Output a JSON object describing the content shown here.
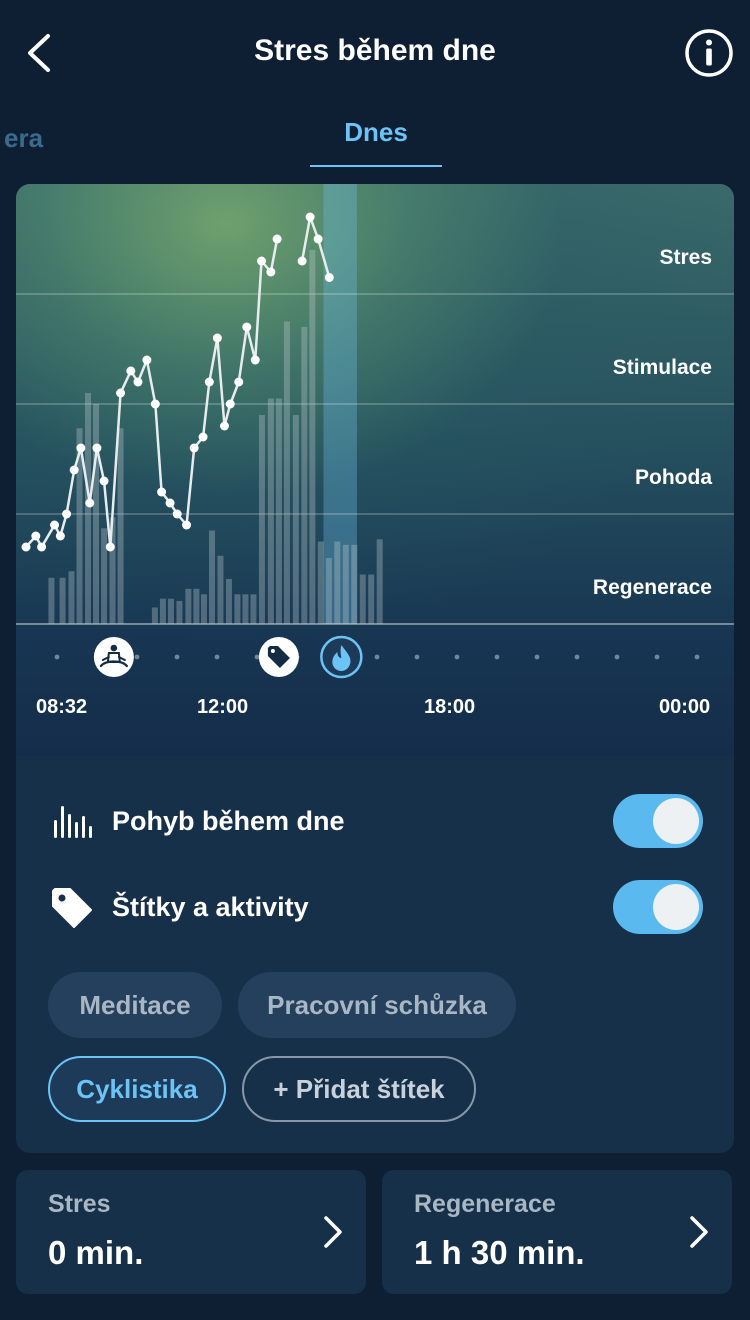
{
  "header": {
    "title": "Stres během dne",
    "back_icon": "chevron-left-icon",
    "info_icon": "info-icon"
  },
  "tabs": {
    "previous_partial": "era",
    "active": "Dnes"
  },
  "colors": {
    "accent": "#6cc3f5",
    "line": "#e8ecef",
    "bars": "rgba(190,200,205,0.35)",
    "highlight": "rgba(110,190,230,0.35)"
  },
  "chart_data": {
    "type": "line",
    "zones": [
      "Stres",
      "Stimulace",
      "Pohoda",
      "Regenerace"
    ],
    "x_ticks": [
      "08:32",
      "12:00",
      "18:00",
      "00:00"
    ],
    "x_range": [
      8.53,
      24
    ],
    "level_series": {
      "x": [
        8.53,
        8.75,
        8.88,
        9.17,
        9.3,
        9.44,
        9.61,
        9.76,
        9.96,
        10.12,
        10.28,
        10.42,
        10.65,
        10.88,
        11.04,
        11.24,
        11.43,
        11.57,
        11.76,
        11.92,
        12.13,
        12.3,
        12.5,
        12.64,
        12.82,
        12.98,
        13.11,
        13.3,
        13.48,
        13.67,
        13.81,
        14.02,
        14.16,
        14.72,
        14.9,
        15.08,
        15.33
      ],
      "y": [
        0.7,
        0.8,
        0.7,
        0.9,
        0.8,
        1.0,
        1.4,
        1.6,
        1.1,
        1.6,
        1.3,
        0.7,
        2.1,
        2.3,
        2.2,
        2.4,
        2.0,
        1.2,
        1.1,
        1.0,
        0.9,
        1.6,
        1.7,
        2.2,
        2.6,
        1.8,
        2.0,
        2.2,
        2.7,
        2.4,
        3.3,
        3.2,
        3.5,
        3.3,
        3.7,
        3.5,
        3.15
      ]
    },
    "activity_series": {
      "x": [
        9.1,
        9.35,
        9.55,
        9.73,
        9.92,
        10.1,
        10.28,
        10.47,
        10.65,
        10.84,
        11.03,
        11.22,
        11.42,
        11.6,
        11.78,
        11.97,
        12.17,
        12.35,
        12.52,
        12.7,
        12.89,
        13.08,
        13.27,
        13.45,
        13.63,
        13.82,
        14.02,
        14.2,
        14.38,
        14.58,
        14.77,
        14.95,
        15.14,
        15.32,
        15.51,
        15.7,
        15.89,
        16.08,
        16.27,
        16.46
      ],
      "y": [
        0.42,
        0.42,
        0.48,
        1.78,
        2.1,
        2.0,
        0.87,
        0.97,
        1.78,
        0,
        0,
        0,
        0.15,
        0.23,
        0.23,
        0.21,
        0.32,
        0.32,
        0.27,
        0.85,
        0.62,
        0.41,
        0.27,
        0.27,
        0.27,
        1.9,
        2.05,
        2.05,
        2.75,
        1.9,
        2.7,
        3.4,
        0.75,
        0.6,
        0.75,
        0.72,
        0.72,
        0.45,
        0.45,
        0.77
      ]
    },
    "highlight_range": [
      15.2,
      15.95
    ]
  },
  "markers": [
    {
      "name": "meditation-icon",
      "time": 10.5
    },
    {
      "name": "tag-icon",
      "time": 14.2
    },
    {
      "name": "fire-icon",
      "time": 15.6
    }
  ],
  "toggles": [
    {
      "label": "Pohyb během dne",
      "icon": "movement-bars-icon",
      "on": true
    },
    {
      "label": "Štítky a aktivity",
      "icon": "tag-icon",
      "on": true
    }
  ],
  "chips": {
    "meditation": "Meditace",
    "meeting": "Pracovní schůzka",
    "cycling": "Cyklistika",
    "add": "+ Přidat štítek"
  },
  "cards": [
    {
      "label": "Stres",
      "value": "0 min."
    },
    {
      "label": "Regenerace",
      "value": "1 h 30 min."
    }
  ]
}
